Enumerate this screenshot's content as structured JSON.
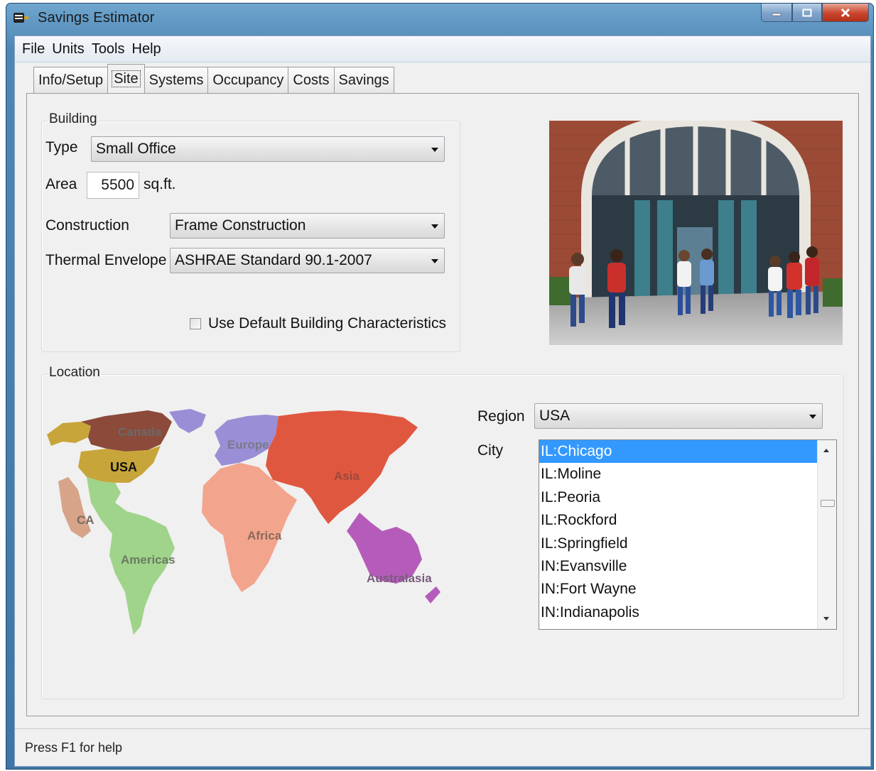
{
  "window": {
    "title": "Savings Estimator"
  },
  "menu": [
    "File",
    "Units",
    "Tools",
    "Help"
  ],
  "tabs": [
    "Info/Setup",
    "Site",
    "Systems",
    "Occupancy",
    "Costs",
    "Savings"
  ],
  "active_tab": "Site",
  "building": {
    "group_label": "Building",
    "type_label": "Type",
    "type_value": "Small Office",
    "area_label": "Area",
    "area_value": "5500",
    "area_unit": "sq.ft.",
    "construction_label": "Construction",
    "construction_value": "Frame Construction",
    "thermal_label": "Thermal Envelope",
    "thermal_value": "ASHRAE Standard 90.1-2007",
    "default_checkbox_label": "Use Default Building Characteristics",
    "default_checked": false
  },
  "location": {
    "group_label": "Location",
    "region_label": "Region",
    "region_value": "USA",
    "city_label": "City",
    "cities": [
      "IL:Chicago",
      "IL:Moline",
      "IL:Peoria",
      "IL:Rockford",
      "IL:Springfield",
      "IN:Evansville",
      "IN:Fort Wayne",
      "IN:Indianapolis"
    ],
    "selected_city": "IL:Chicago",
    "map_labels": {
      "canada": "Canada",
      "usa": "USA",
      "ca": "CA",
      "americas": "Americas",
      "europe": "Europe",
      "asia": "Asia",
      "africa": "Africa",
      "australasia": "Australasia"
    },
    "map_colors": {
      "canada": "#8b4a3a",
      "alaska": "#c8a53a",
      "usa": "#c8a53a",
      "ca": "#d7a48a",
      "americas": "#9fd48a",
      "europe": "#9a8fd6",
      "asia": "#e0573f",
      "africa": "#f3a48d",
      "australasia": "#b55cba"
    }
  },
  "status": {
    "text": "Press F1 for help"
  }
}
